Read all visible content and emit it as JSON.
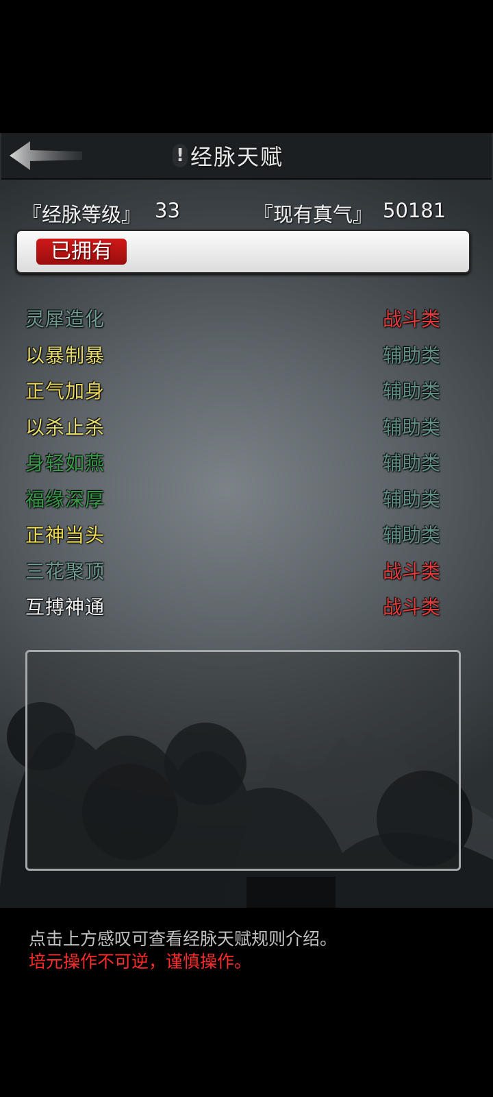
{
  "header": {
    "title": "经脉天赋",
    "info_icon": "!"
  },
  "stats": {
    "level_label": "『经脉等级』",
    "level_value": "33",
    "qi_label": "『现有真气』",
    "qi_value": "50181"
  },
  "tabs": [
    {
      "label": "已拥有",
      "selected": true
    }
  ],
  "talents": [
    {
      "name": "灵犀造化",
      "type": "战斗类",
      "name_color": "#6f9c92",
      "type_color": "#e53a3a"
    },
    {
      "name": "以暴制暴",
      "type": "辅助类",
      "name_color": "#e6db6a",
      "type_color": "#5e8e86"
    },
    {
      "name": "正气加身",
      "type": "辅助类",
      "name_color": "#ead65c",
      "type_color": "#5e8e86"
    },
    {
      "name": "以杀止杀",
      "type": "辅助类",
      "name_color": "#e6db6a",
      "type_color": "#5e8e86"
    },
    {
      "name": "身轻如燕",
      "type": "辅助类",
      "name_color": "#3a9a4a",
      "type_color": "#5e8e86"
    },
    {
      "name": "福缘深厚",
      "type": "辅助类",
      "name_color": "#3a9a4a",
      "type_color": "#5e8e86"
    },
    {
      "name": "正神当头",
      "type": "辅助类",
      "name_color": "#f0de56",
      "type_color": "#5e8e86"
    },
    {
      "name": "三花聚顶",
      "type": "战斗类",
      "name_color": "#6f9c92",
      "type_color": "#e53a3a"
    },
    {
      "name": "互搏神通",
      "type": "战斗类",
      "name_color": "#f2f2f2",
      "type_color": "#e53a3a"
    }
  ],
  "hints": {
    "info": "点击上方感叹可查看经脉天赋规则介绍。",
    "warning": "培元操作不可逆，谨慎操作。"
  },
  "icons": {
    "back": "back-arrow-icon",
    "info": "exclamation-icon"
  }
}
